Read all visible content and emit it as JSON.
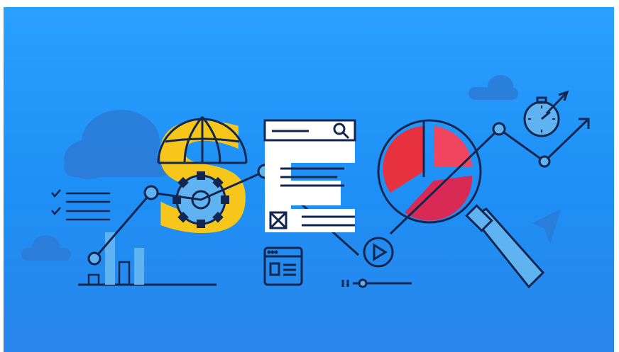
{
  "scene": {
    "headline": "SEO",
    "letters": [
      "S",
      "E",
      "O"
    ],
    "background_color": "#2196F3",
    "colors": {
      "navy": "#12264f",
      "yellow": "#f7c61a",
      "white": "#ffffff",
      "red": "#e8313f",
      "pink": "#f0455f",
      "light_blue": "#5fb3f0",
      "cloud": "#2c7bd6"
    },
    "icons": [
      "globe-icon",
      "gear-icon",
      "search-icon",
      "checkbox-x-icon",
      "pie-chart-icon",
      "magnifier-icon",
      "stopwatch-icon",
      "arrow-icon",
      "play-icon",
      "browser-window-icon",
      "checklist-icon",
      "bar-chart-icon",
      "cursor-icon",
      "cloud-icon",
      "slider-icon"
    ]
  }
}
